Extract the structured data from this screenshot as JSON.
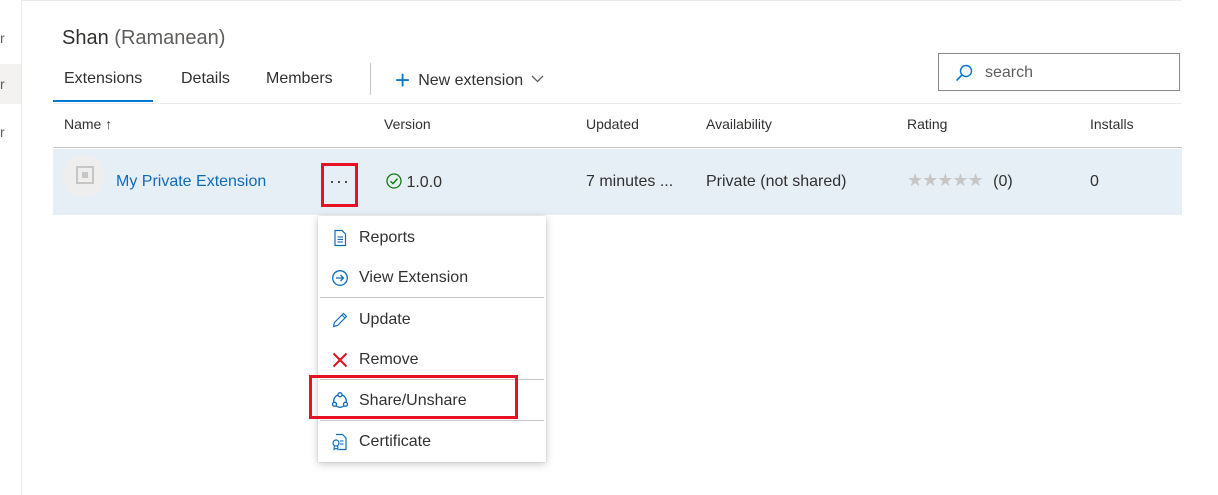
{
  "rail": {
    "items": [
      "r",
      "r",
      "r"
    ]
  },
  "header": {
    "title": "Shan",
    "subtitle": "(Ramanean)"
  },
  "tabs": [
    {
      "label": "Extensions"
    },
    {
      "label": "Details"
    },
    {
      "label": "Members"
    }
  ],
  "toolbar": {
    "new_extension_label": "New extension"
  },
  "search": {
    "placeholder": "search"
  },
  "grid": {
    "columns": {
      "name": "Name ↑",
      "version": "Version",
      "updated": "Updated",
      "availability": "Availability",
      "rating": "Rating",
      "installs": "Installs"
    },
    "rows": [
      {
        "name": "My Private Extension",
        "more": "···",
        "version": "1.0.0",
        "updated": "7 minutes ...",
        "availability": "Private (not shared)",
        "stars": "★★★★★",
        "rating_count": "(0)",
        "installs": "0"
      }
    ]
  },
  "context_menu": {
    "items": [
      {
        "label": "Reports",
        "icon": "report-icon"
      },
      {
        "label": "View Extension",
        "icon": "arrow-circle-icon"
      },
      {
        "label": "Update",
        "icon": "pencil-icon"
      },
      {
        "label": "Remove",
        "icon": "close-icon"
      },
      {
        "label": "Share/Unshare",
        "icon": "share-icon"
      },
      {
        "label": "Certificate",
        "icon": "certificate-icon"
      }
    ]
  },
  "colors": {
    "accent": "#0078d4",
    "link": "#0f6cbd",
    "row_selected": "#e6eef6",
    "annotation_red": "#e81123",
    "remove_red": "#e81123",
    "success_green": "#107c10"
  }
}
